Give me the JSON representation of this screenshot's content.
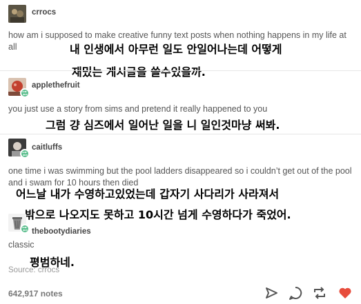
{
  "posts": [
    {
      "username": "crrocs",
      "text": "how am i supposed to make creative funny text posts when nothing happens in my life at all",
      "translation": [
        "내 인생에서 아무런 일도 안일어나는데 어떻게",
        "재밌는 게시글을 쓸수있을까."
      ]
    },
    {
      "username": "applethefruit",
      "text": "you just use a story from sims and pretend it really happened to you",
      "translation": [
        "그럼 걍 심즈에서 일어난 일을 니 일인것마냥 써봐."
      ]
    },
    {
      "username": "caitluffs",
      "text": "one time i was swimming but the pool ladders disappeared so i couldn’t get out of the pool and i swam for 10 hours then died",
      "translation": [
        "어느날 내가 수영하고있었는데 갑자기 사다리가 사라져서",
        "밖으로 나오지도 못하고 10시간 넘게 수영하다가 죽었어."
      ]
    },
    {
      "username": "thebootydiaries",
      "text": "classic",
      "translation": [
        "평범하네."
      ]
    }
  ],
  "source": {
    "label": "Source:",
    "name": "crrocs"
  },
  "footer": {
    "notes": "642,917 notes",
    "icons": [
      "share-icon",
      "reply-icon",
      "reblog-icon",
      "like-icon"
    ],
    "like_color": "#e74c3c"
  },
  "colors": {
    "reblog_badge": "#56bc8a",
    "text": "#555555",
    "divider": "#e6e6e6"
  }
}
